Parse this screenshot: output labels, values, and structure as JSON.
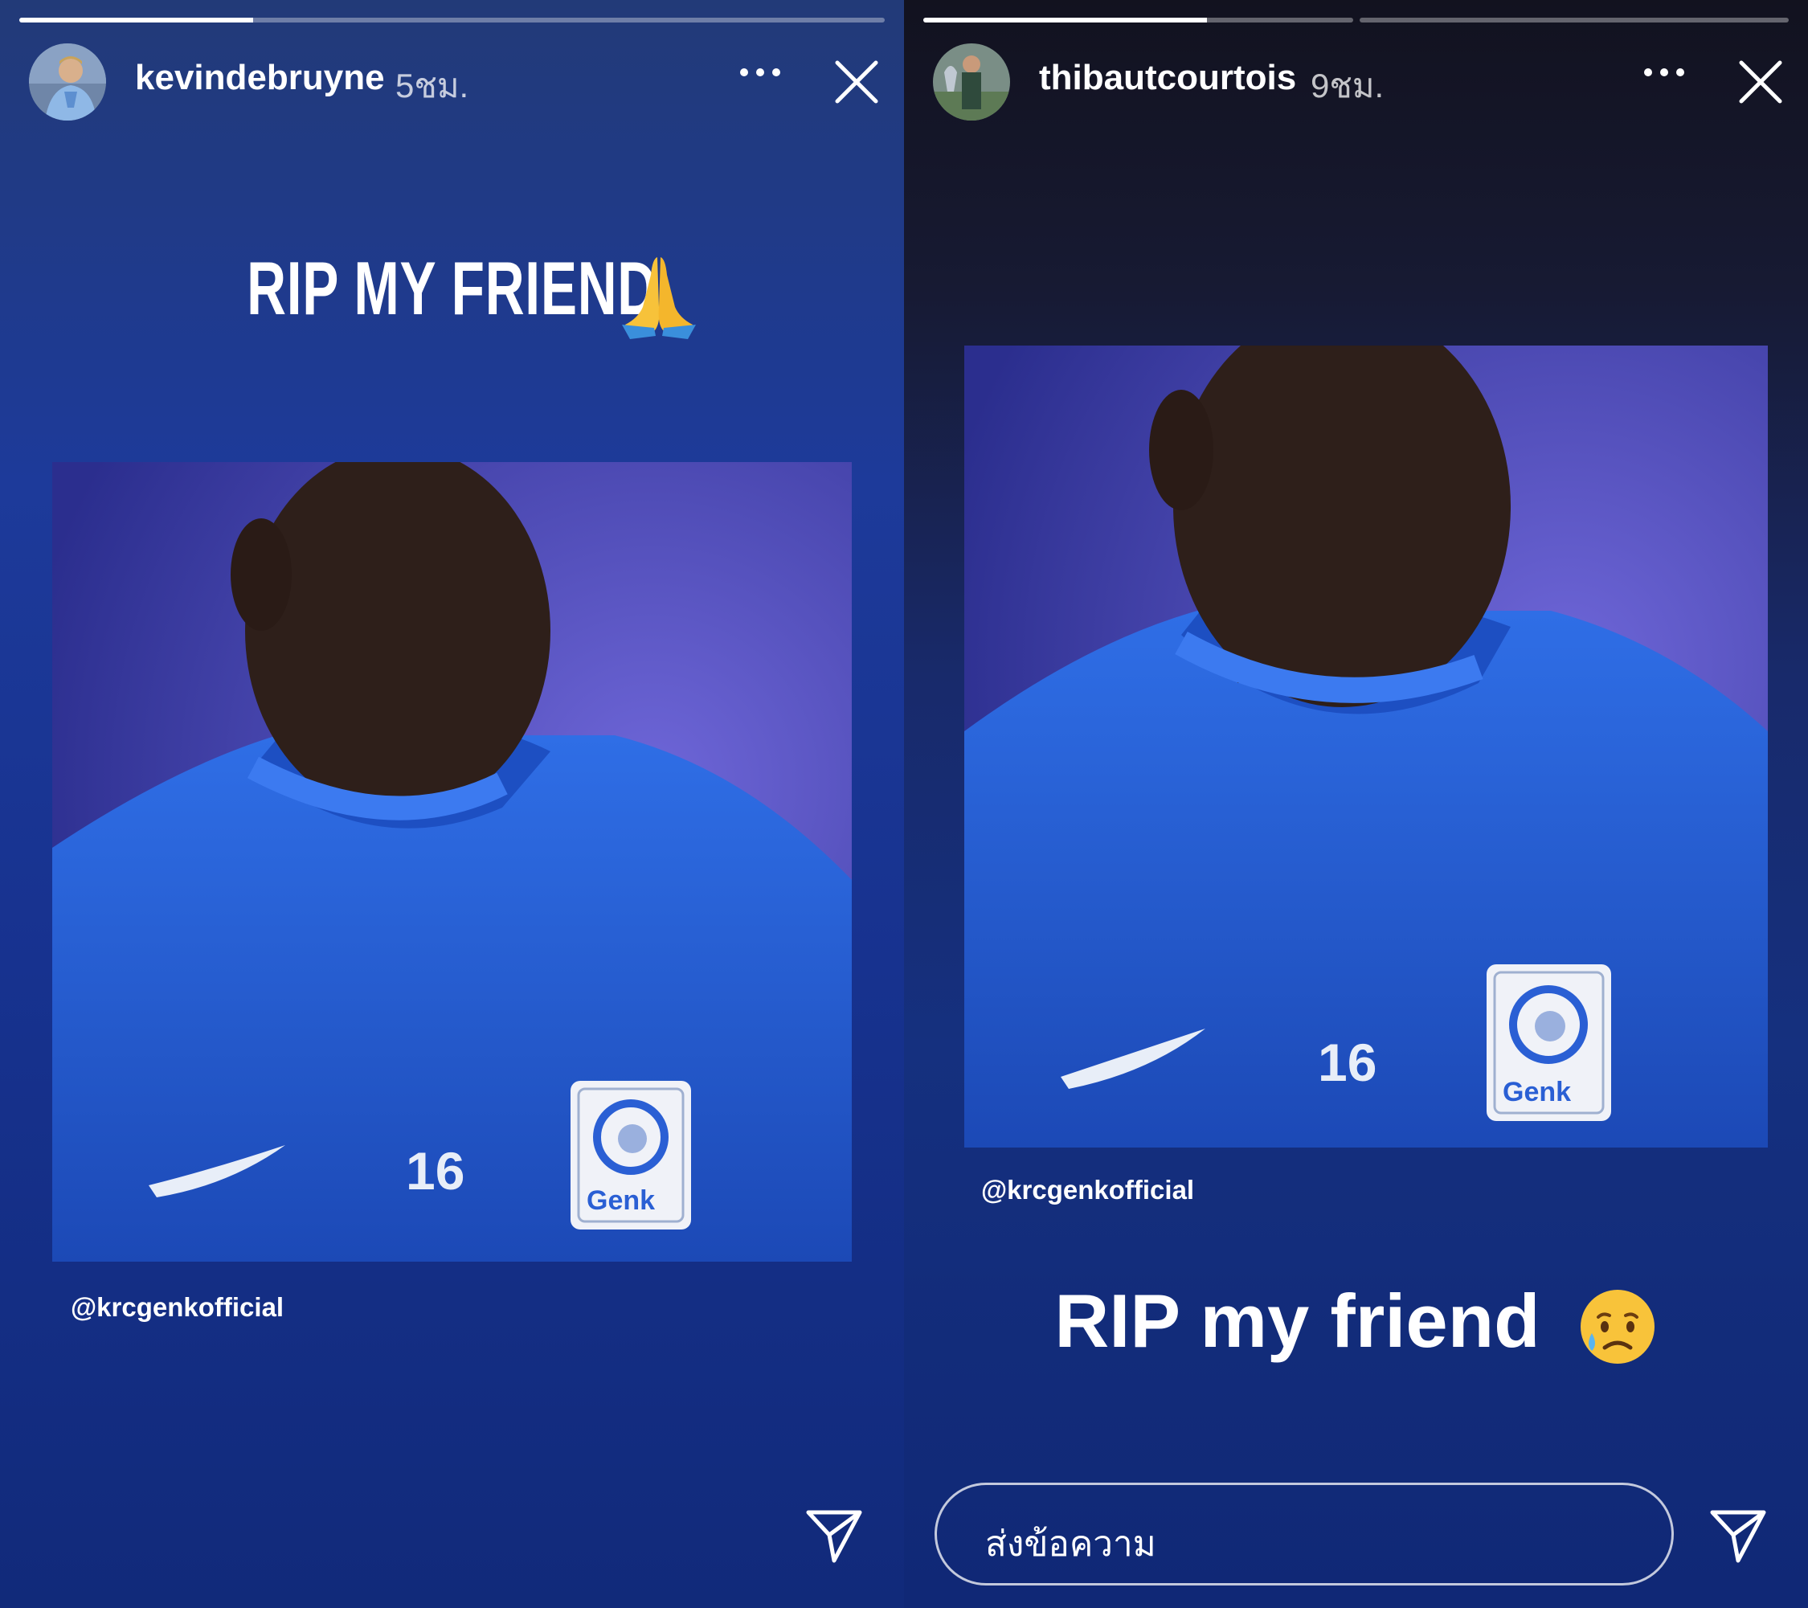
{
  "left_story": {
    "username": "kevindebruyne",
    "time": "5ชม.",
    "progress": 0.27,
    "caption": "RIP MY FRIEND",
    "caption_emoji": "praying-hands",
    "photo": {
      "jersey_number": "16",
      "badge_text": "Genk"
    },
    "credit": "@krcgenkofficial"
  },
  "right_story": {
    "username": "thibautcourtois",
    "time": "9ชม.",
    "progress_segments": [
      0.66,
      0
    ],
    "caption": "RIP my friend",
    "caption_emoji": "sad-but-relieved-face",
    "photo": {
      "jersey_number": "16",
      "badge_text": "Genk"
    },
    "credit": "@krcgenkofficial",
    "reply_placeholder": "ส่งข้อความ"
  },
  "colors": {
    "left_bg": "#1d3a9a",
    "right_bg_top": "#12121f",
    "jersey": "#2a63d6",
    "text": "#ffffff"
  }
}
